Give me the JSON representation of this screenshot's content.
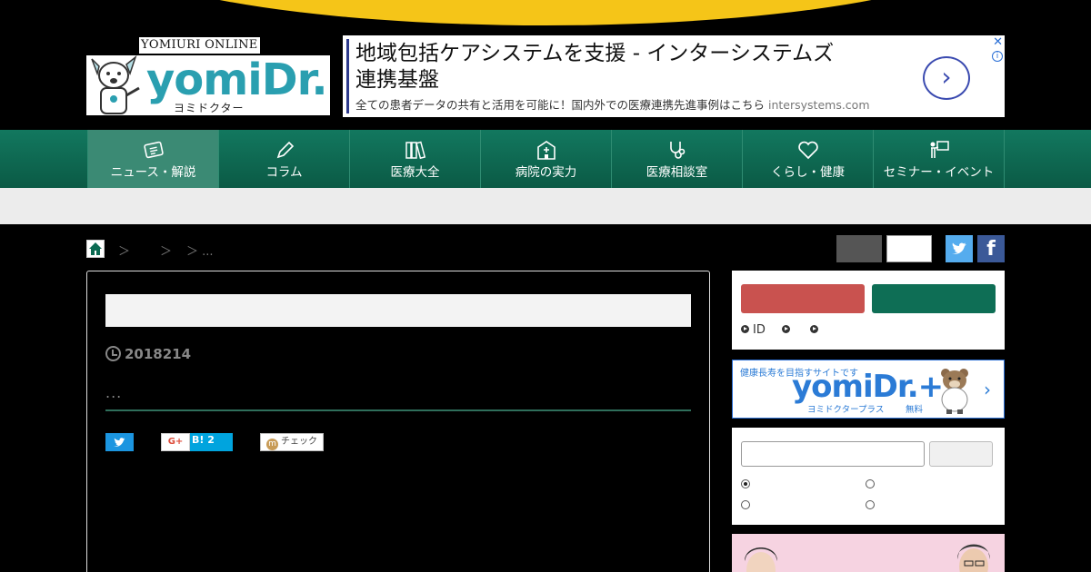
{
  "header": {
    "brand_top": "YOMIURI ONLINE",
    "brand_name": "yomiDr.",
    "brand_kana": "ヨミドクター",
    "brand_color": "#2a9fb0"
  },
  "ad": {
    "title_line1": "地域包括ケアシステムを支援 - インターシステムズ",
    "title_line2": "連携基盤",
    "description": "全ての患者データの共有と活用を可能に！国内外での医療連携先進事例はこちら",
    "domain": "intersystems.com",
    "arrow": "›",
    "close": "✕",
    "info": "i"
  },
  "nav": {
    "color": "#0b6a52",
    "items": [
      {
        "label": "ニュース・解説",
        "icon": "newspaper-icon",
        "active": true
      },
      {
        "label": "コラム",
        "icon": "pen-icon"
      },
      {
        "label": "医療大全",
        "icon": "books-icon"
      },
      {
        "label": "病院の実力",
        "icon": "hospital-icon"
      },
      {
        "label": "医療相談室",
        "icon": "stethoscope-icon"
      },
      {
        "label": "くらし・健康",
        "icon": "heart-icon"
      },
      {
        "label": "セミナー・イベント",
        "icon": "presenter-icon"
      }
    ]
  },
  "breadcrumb": {
    "sep1": "＞",
    "sep2": "＞",
    "sep3": "＞ ..."
  },
  "article": {
    "date": "2018214",
    "lead": "...",
    "share_hatena_count": "B! 2",
    "share_gplus": "G+",
    "share_mixi": "チェック"
  },
  "sidebar": {
    "login_links": [
      "ID",
      "",
      ""
    ],
    "banner_top": "健康長寿を目指すサイトです",
    "banner_logo": "yomiDr.+",
    "banner_kana": "ヨミドクタープラス",
    "banner_free": "無料",
    "banner_chevron": "›"
  },
  "social": {
    "facebook": "f"
  }
}
